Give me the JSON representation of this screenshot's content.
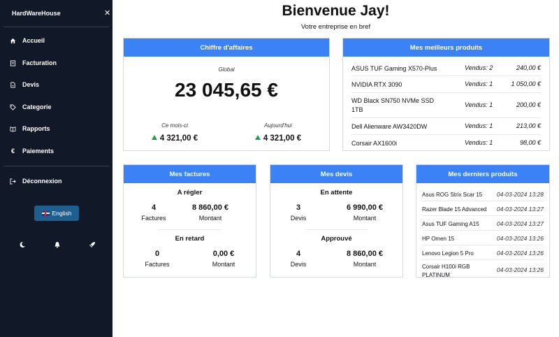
{
  "sidebar": {
    "brand": "HardWareHouse",
    "close_icon": "close-icon",
    "items": [
      {
        "label": "Accueil",
        "icon": "home-icon"
      },
      {
        "label": "Facturation",
        "icon": "invoice-icon"
      },
      {
        "label": "Devis",
        "icon": "file-icon"
      },
      {
        "label": "Categorie",
        "icon": "tag-icon"
      },
      {
        "label": "Rapports",
        "icon": "book-icon"
      },
      {
        "label": "Paiements",
        "icon": "euro-icon"
      }
    ],
    "logout": {
      "label": "Déconnexion",
      "icon": "logout-icon"
    },
    "language": {
      "label": "English",
      "icon": "uk-flag-icon"
    },
    "bottom_icons": [
      "moon-icon",
      "bell-icon",
      "rocket-icon"
    ],
    "colors": {
      "background": "#111827",
      "language_button": "#1e5f8f"
    }
  },
  "header": {
    "title": "Bienvenue Jay!",
    "subtitle": "Votre entreprise en bref"
  },
  "revenue": {
    "title": "Chiffre d'affaires",
    "global_label": "Global",
    "global_value": "23 045,65 €",
    "month_label": "Ce mois-ci",
    "month_value": "4 321,00 €",
    "today_label": "Aujourd'hui",
    "today_value": "4 321,00 €"
  },
  "best_products": {
    "title": "Mes meilleurs produits",
    "rows": [
      {
        "name": "ASUS TUF Gaming X570-Plus",
        "sold": "Vendus: 2",
        "price": "240,00 €"
      },
      {
        "name": "NVIDIA RTX 3090",
        "sold": "Vendus: 1",
        "price": "1 050,00 €"
      },
      {
        "name": "WD Black SN750 NVMe SSD 1TB",
        "sold": "Vendus: 1",
        "price": "200,00 €"
      },
      {
        "name": "Dell Alienware AW3420DW",
        "sold": "Vendus: 1",
        "price": "213,00 €"
      },
      {
        "name": "Corsair AX1600i",
        "sold": "Vendus: 1",
        "price": "98,00 €"
      }
    ]
  },
  "invoices": {
    "title": "Mes factures",
    "section1": {
      "title": "A régler",
      "count": "4",
      "count_label": "Factures",
      "amount": "8 860,00 €",
      "amount_label": "Montant"
    },
    "section2": {
      "title": "En retard",
      "count": "0",
      "count_label": "Factures",
      "amount": "0,00 €",
      "amount_label": "Montant"
    }
  },
  "quotes": {
    "title": "Mes devis",
    "section1": {
      "title": "En attente",
      "count": "3",
      "count_label": "Devis",
      "amount": "6 990,00 €",
      "amount_label": "Montant"
    },
    "section2": {
      "title": "Approuvé",
      "count": "4",
      "count_label": "Devis",
      "amount": "8 860,00 €",
      "amount_label": "Montant"
    }
  },
  "latest_products": {
    "title": "Mes derniers produits",
    "rows": [
      {
        "name": "Asus ROG Strix Scar 15",
        "date": "04-03-2024 13:28"
      },
      {
        "name": "Razer Blade 15 Advanced",
        "date": "04-03-2024 13:27"
      },
      {
        "name": "Asus TUF Gaming A15",
        "date": "04-03-2024 13:27"
      },
      {
        "name": "HP Omen 15",
        "date": "04-03-2024 13:26"
      },
      {
        "name": "Lenovo Legion 5 Pro",
        "date": "04-03-2024 13:26"
      },
      {
        "name": "Corsair H100i RGB PLATINUM",
        "date": "04-03-2024 13:26"
      }
    ]
  },
  "colors": {
    "accent": "#3b82f6",
    "trend_up": "#16a34a"
  }
}
